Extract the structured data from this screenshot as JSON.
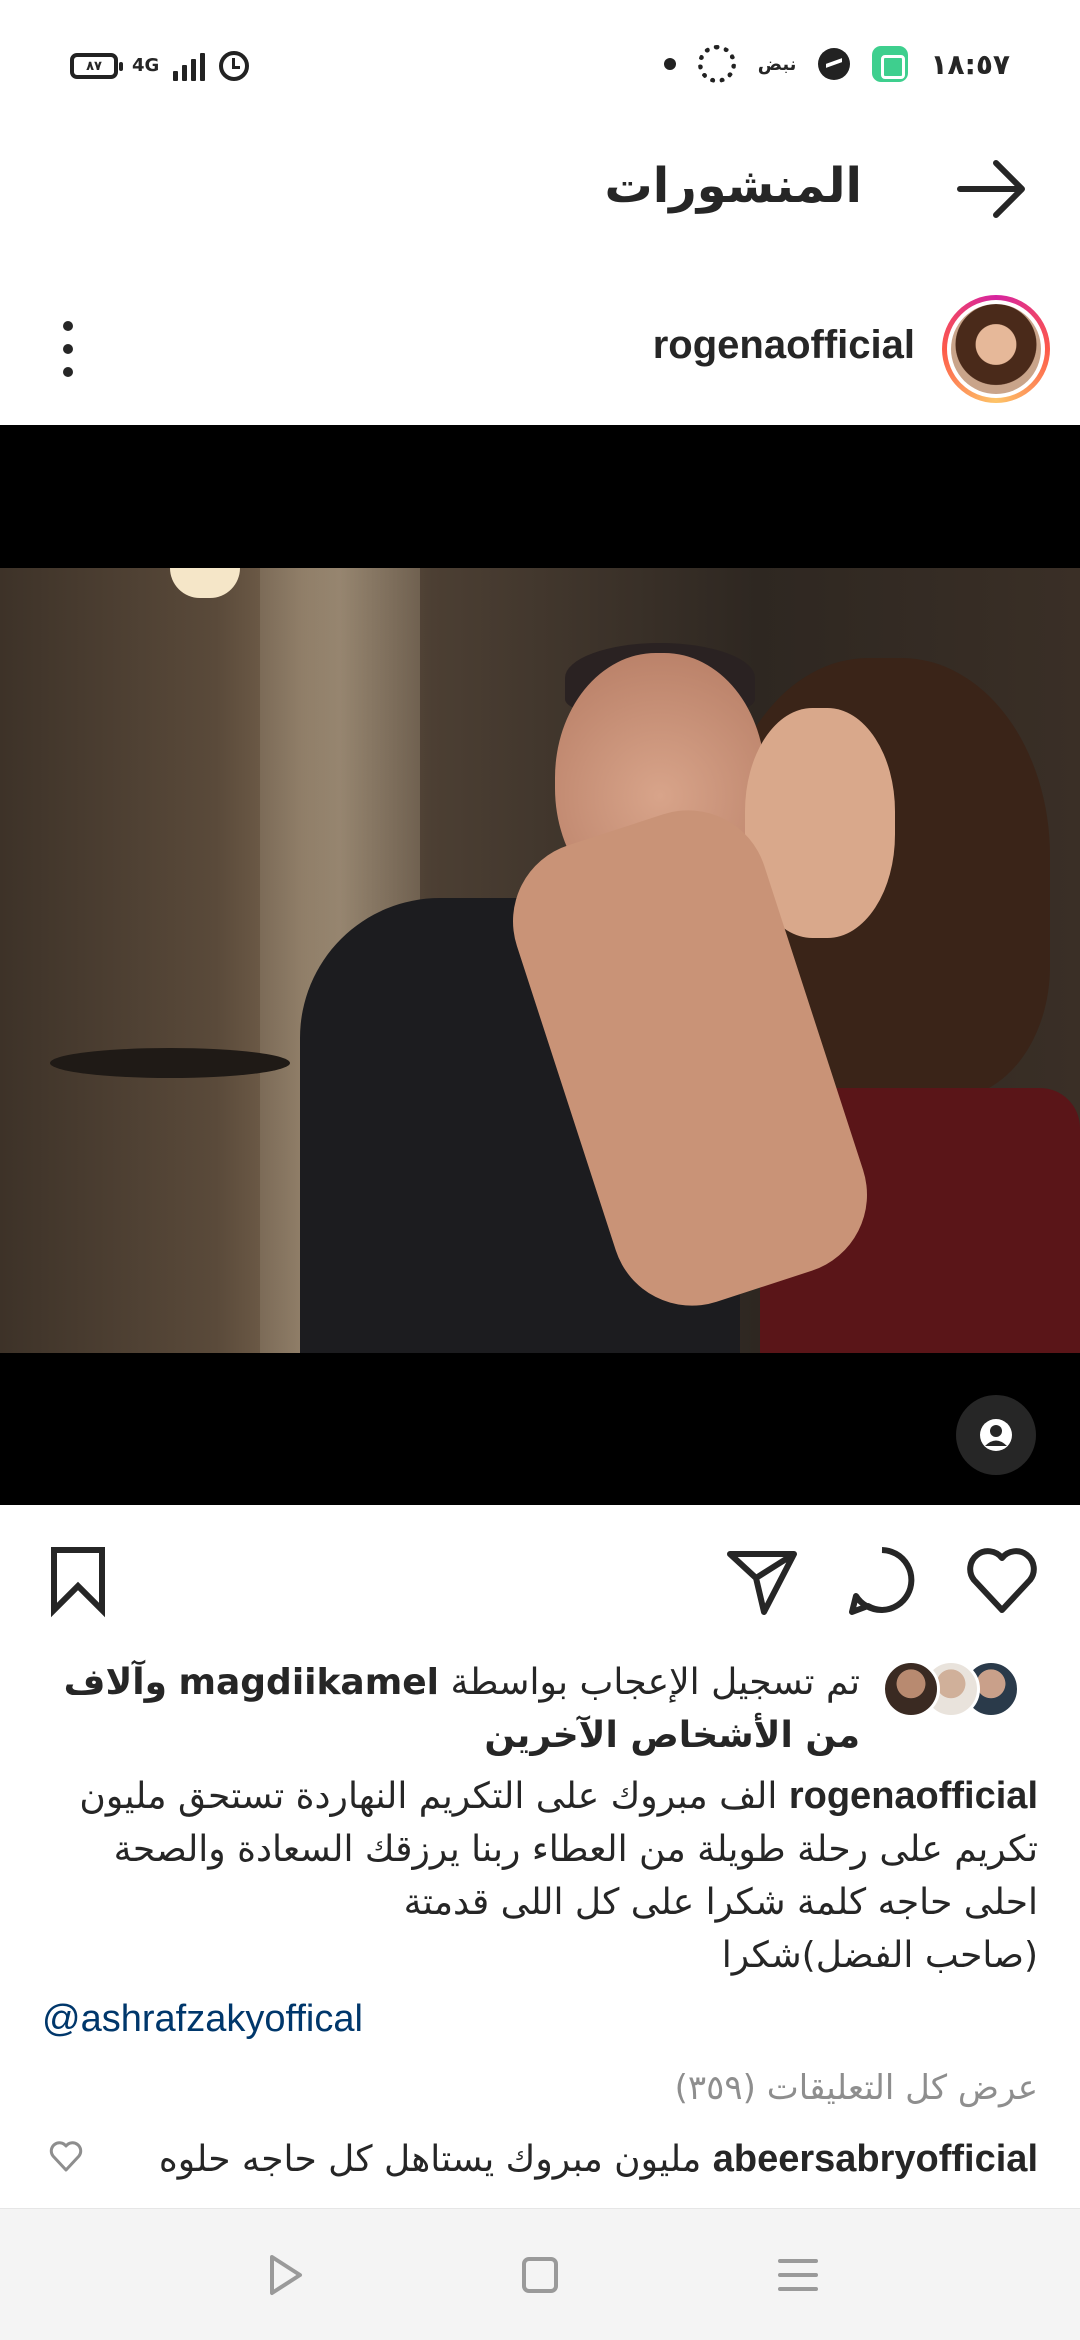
{
  "status_bar": {
    "battery": "٨٧",
    "network": "4G",
    "notification_label": "نبض",
    "time": "١٨:٥٧"
  },
  "header": {
    "title": "المنشورات",
    "back_icon": "arrow-right-icon"
  },
  "post": {
    "username": "rogenaofficial",
    "media_background": "#000000",
    "likes": {
      "prefix": "تم تسجيل الإعجاب بواسطة",
      "liker": "magdiikamel",
      "suffix": "وآلاف من الأشخاص الآخرين"
    },
    "caption": {
      "username": "rogenaofficial",
      "line1": "الف مبروك على التكريم النهاردة تستحق  مليون",
      "line2": "تكريم على رحلة طويلة من العطاء ربنا يرزقك السعادة والصحة",
      "line3": "احلى حاجه كلمة شكرا على كل اللى قدمتة",
      "line4": "(صاحب الفضل)شكرا"
    },
    "mention": "@ashrafzakyoffical",
    "view_comments": "عرض كل التعليقات (٣٥٩)",
    "comment": {
      "username": "abeersabryofficial",
      "text": "مليون مبروك يستاهل كل حاجه حلوه"
    }
  },
  "colors": {
    "link": "#00376b",
    "muted": "#8e8e8e",
    "text": "#262626"
  }
}
